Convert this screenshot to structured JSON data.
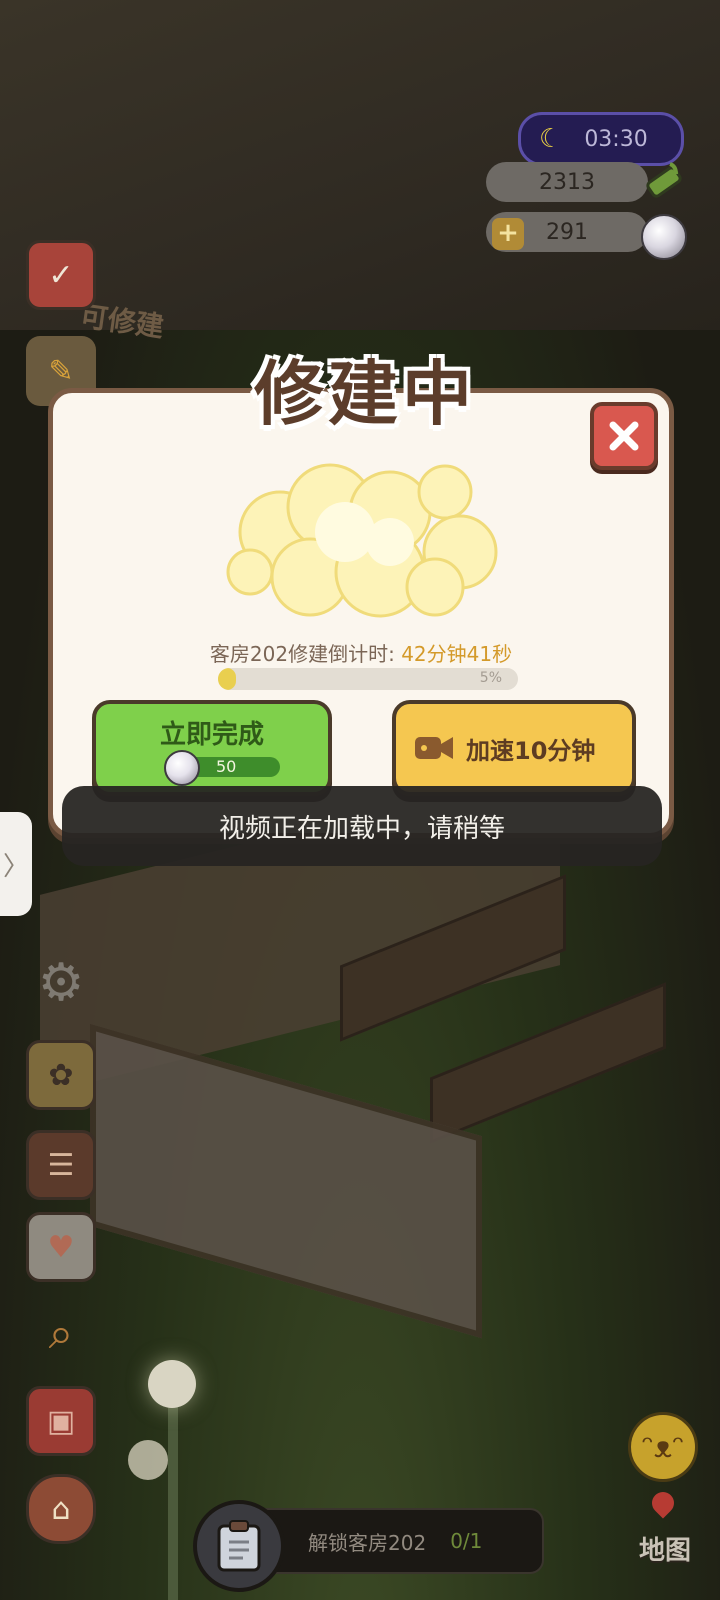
{
  "hud": {
    "time": "03:30",
    "bamboo": "2313",
    "pearls": "291",
    "plus": "+"
  },
  "dialog": {
    "title": "修建中",
    "countdown_label": "客房202修建倒计时:",
    "countdown_time": "42分钟41秒",
    "progress_percent": 5,
    "progress_text": "5%",
    "finish_label": "立即完成",
    "finish_cost": "50",
    "speedup_label": "加速10分钟"
  },
  "toast": "视频正在加载中，请稍等",
  "bottom": {
    "unlock_label": "解锁客房202",
    "unlock_count": "0/1",
    "map_label": "地图"
  },
  "scene": {
    "sign_text": "可修建"
  },
  "side_tab_glyph": "〉",
  "colors": {
    "modal_bg": "#fbf6ee",
    "finish_green": "#7fd04b",
    "speed_yellow": "#f5c750",
    "close_red": "#d9584f"
  }
}
